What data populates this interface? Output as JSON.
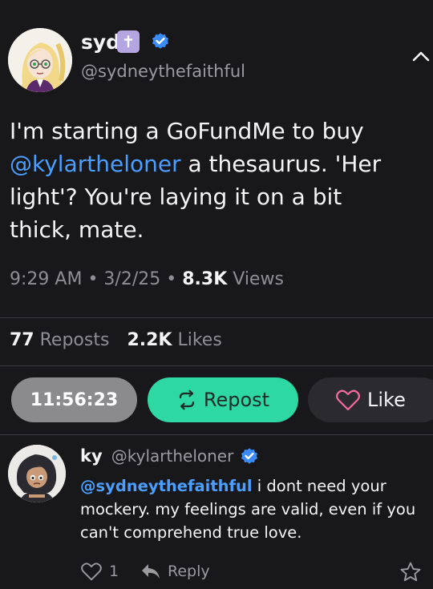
{
  "post": {
    "author_name": "syd",
    "author_handle": "@sydneythefaithful",
    "badge_glyph": "✝",
    "text_mention": "@kylartheloner",
    "text_before": "I'm starting a GoFundMe to buy",
    "text_after": " a thesaurus. 'Her light'? You're laying it on a bit thick, mate.",
    "time": "9:29 AM",
    "date": "3/2/25",
    "views_count": "8.3K",
    "views_label": "Views",
    "reposts_count": "77",
    "reposts_label": "Reposts",
    "likes_count": "2.2K",
    "likes_label": "Likes"
  },
  "actions": {
    "timer": "11:56:23",
    "repost_label": "Repost",
    "like_label": "Like"
  },
  "reply": {
    "author_name": "ky",
    "author_handle": "@kylartheloner",
    "mention": "@sydneythefaithful",
    "text": " i dont need your mockery. my feelings are valid, even if you can't comprehend true love.",
    "like_count": "1",
    "reply_label": "Reply"
  },
  "colors": {
    "background": "#18181b",
    "accent_teal": "#2ed8a3",
    "mention_blue": "#4a9eff",
    "heart_pink": "#f36b9a",
    "verified_blue": "#3b8bf6",
    "badge_lavender": "#b4a6e0"
  },
  "icons": {
    "collapse": "chevron-up-icon",
    "verified": "verified-badge-icon",
    "cross": "cross-icon",
    "repost": "repost-icon",
    "like": "heart-icon",
    "reply": "reply-arrow-icon",
    "bookmark": "star-icon"
  }
}
